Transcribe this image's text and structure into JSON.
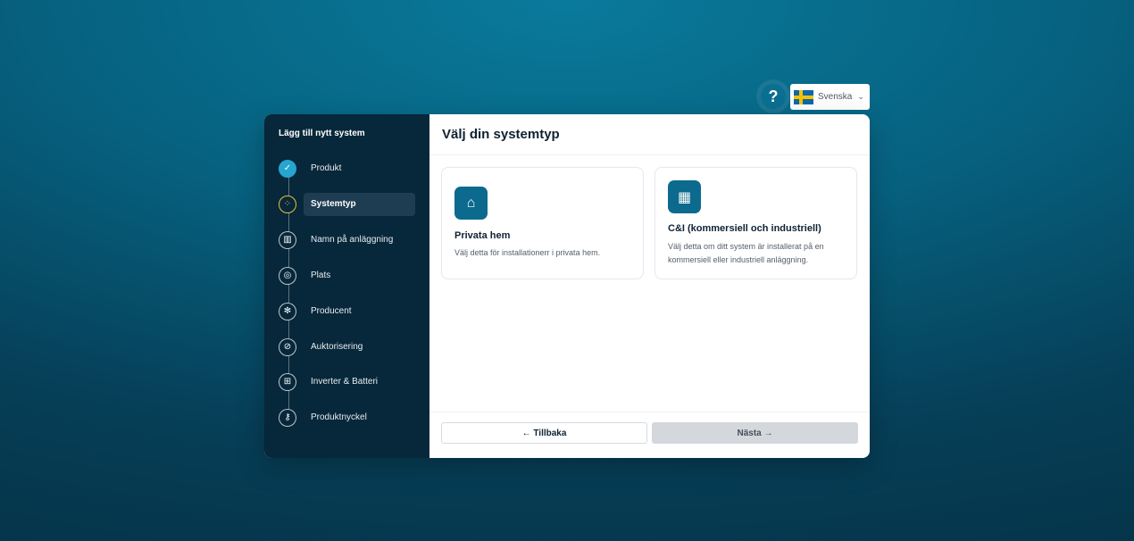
{
  "header": {
    "help_label": "?",
    "language": "Svenska",
    "flag_icon": "sweden-flag-icon"
  },
  "sidebar": {
    "title": "Lägg till nytt system",
    "steps": [
      {
        "label": "Produkt",
        "state": "done",
        "icon": "check-icon"
      },
      {
        "label": "Systemtyp",
        "state": "active",
        "icon": "grid-icon"
      },
      {
        "label": "Namn på anläggning",
        "state": "pending",
        "icon": "building-icon"
      },
      {
        "label": "Plats",
        "state": "pending",
        "icon": "location-pin-icon"
      },
      {
        "label": "Producent",
        "state": "pending",
        "icon": "fan-icon"
      },
      {
        "label": "Auktorisering",
        "state": "pending",
        "icon": "link-icon"
      },
      {
        "label": "Inverter & Batteri",
        "state": "pending",
        "icon": "battery-icon"
      },
      {
        "label": "Produktnyckel",
        "state": "pending",
        "icon": "key-icon"
      }
    ]
  },
  "main": {
    "title": "Välj din systemtyp",
    "options": [
      {
        "title": "Privata hem",
        "description": "Välj detta för installationerr i privata hem.",
        "icon": "house-icon"
      },
      {
        "title": "C&I (kommersiell och industriell)",
        "description": "Välj detta om ditt system är installerat på en kommersiell eller industriell anläggning.",
        "icon": "factory-icon"
      }
    ],
    "back_label": "← Tillbaka",
    "next_label": "Nästa →"
  },
  "colors": {
    "accent": "#0b6a8d",
    "sidebar_bg": "#07273a",
    "done_step": "#25a5cf",
    "active_step": "#e8c23a"
  }
}
